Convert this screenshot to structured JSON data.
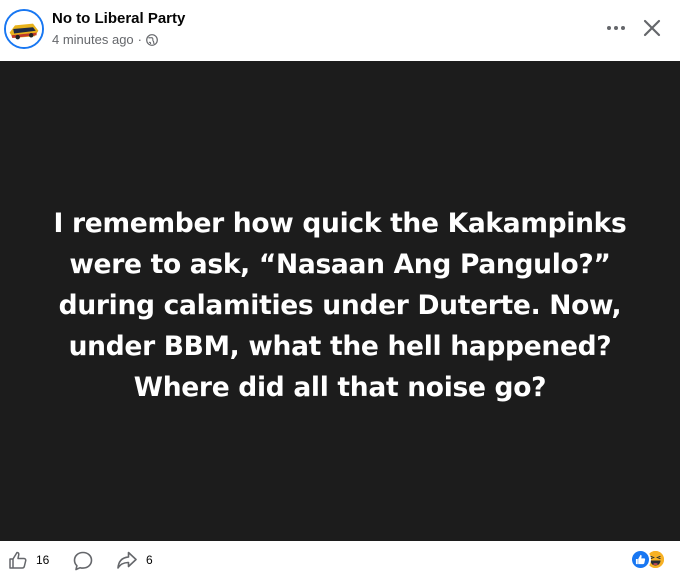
{
  "post": {
    "author": "No to Liberal Party",
    "timestamp": "4 minutes ago",
    "separator": "·",
    "audience_icon": "globe-icon",
    "text": "I remember how quick the Kakampinks were to ask, “Nasaan Ang Pangulo?” during calamities under Duterte. Now, under BBM, what the hell happened? Where did all that noise go?",
    "background_color": "#1c1c1c",
    "text_color": "#ffffff"
  },
  "header": {
    "more_icon": "more-options-icon",
    "close_icon": "close-icon"
  },
  "footer": {
    "like_count": "16",
    "share_count": "6",
    "icons": [
      "like-thumb-icon",
      "comment-icon",
      "share-arrow-icon"
    ],
    "reactions": [
      "like-reaction-icon",
      "haha-reaction-icon"
    ]
  },
  "colors": {
    "accent": "#1877f2",
    "secondary_text": "#65676b",
    "haha": "#f7b125"
  }
}
